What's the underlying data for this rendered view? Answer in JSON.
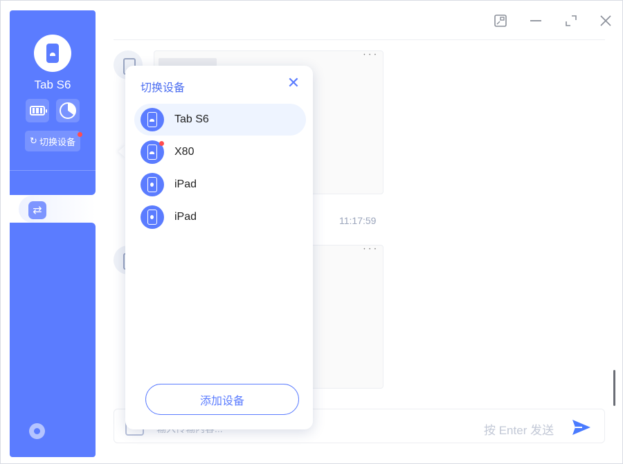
{
  "sidebar": {
    "device_name": "Tab S6",
    "switch_label": "切换设备",
    "switch_icon": "refresh-icon",
    "nav_active_icon": "sync-icon"
  },
  "window_controls": {
    "icons": [
      "screenshot-icon",
      "minimize-icon",
      "maximize-icon",
      "close-icon"
    ]
  },
  "chat": {
    "timestamp": "11:17:59"
  },
  "input": {
    "placeholder": "输入传输内容...",
    "send_hint": "按 Enter 发送"
  },
  "popup": {
    "title": "切换设备",
    "devices": [
      {
        "label": "Tab S6",
        "icon": "android-phone-icon",
        "selected": true,
        "badge": false
      },
      {
        "label": "X80",
        "icon": "android-phone-icon",
        "selected": false,
        "badge": true
      },
      {
        "label": "iPad",
        "icon": "apple-phone-icon",
        "selected": false,
        "badge": false
      },
      {
        "label": "iPad",
        "icon": "apple-phone-icon",
        "selected": false,
        "badge": false
      }
    ],
    "add_button": "添加设备"
  },
  "colors": {
    "brand": "#5b7cff",
    "badge": "#ff4d4f"
  }
}
